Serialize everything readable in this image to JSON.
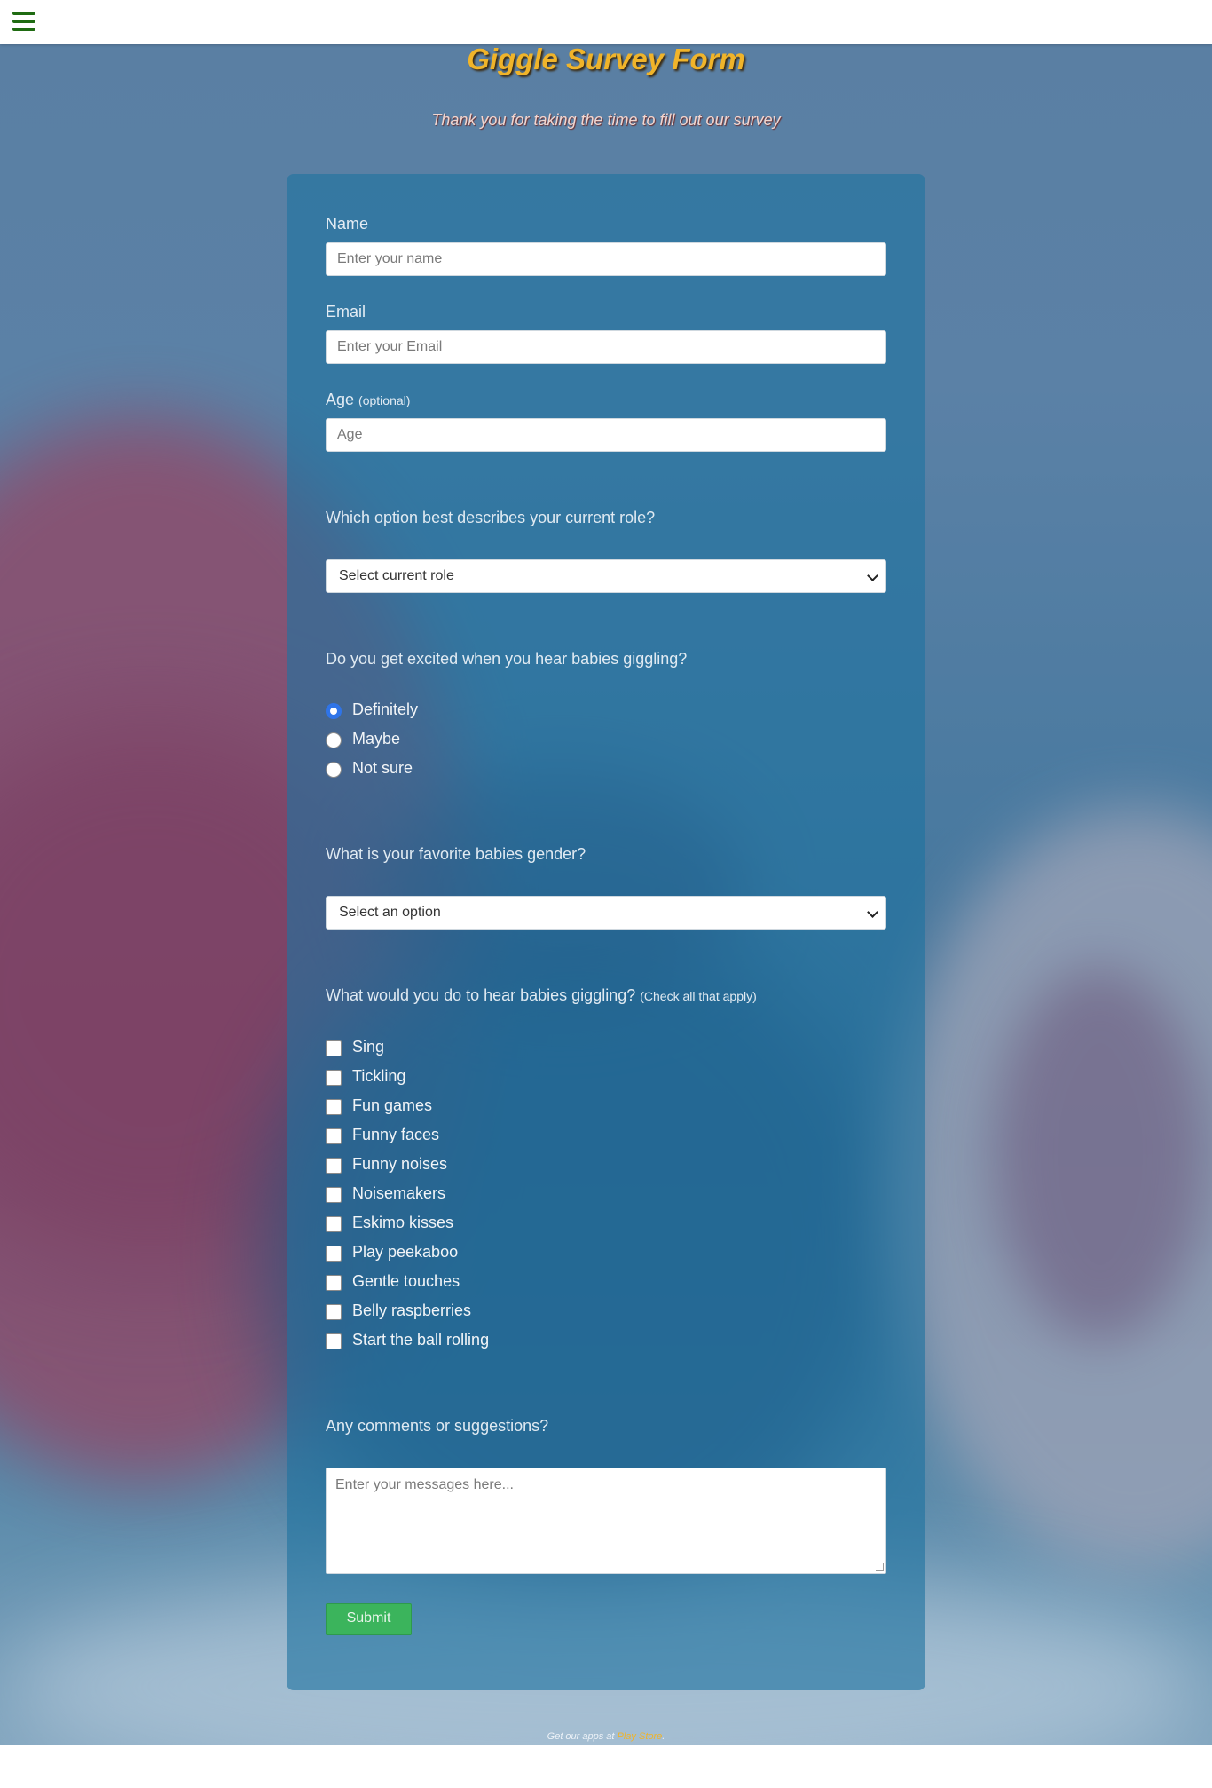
{
  "header": {
    "menu_icon": "hamburger-menu-icon"
  },
  "page": {
    "title": "Giggle Survey Form",
    "subtitle": "Thank you for taking the time to fill out our survey"
  },
  "form": {
    "name": {
      "label": "Name",
      "placeholder": "Enter your name"
    },
    "email": {
      "label": "Email",
      "placeholder": "Enter your Email"
    },
    "age": {
      "label": "Age",
      "hint": "(optional)",
      "placeholder": "Age"
    },
    "role": {
      "question": "Which option best describes your current role?",
      "selected": "Select current role"
    },
    "excited": {
      "question": "Do you get excited when you hear babies giggling?",
      "options": [
        "Definitely",
        "Maybe",
        "Not sure"
      ],
      "selected_index": 0
    },
    "gender": {
      "question": "What is your favorite babies gender?",
      "selected": "Select an option"
    },
    "activities": {
      "question": "What would you do to hear babies giggling?",
      "hint": "(Check all that apply)",
      "options": [
        "Sing",
        "Tickling",
        "Fun games",
        "Funny faces",
        "Funny noises",
        "Noisemakers",
        "Eskimo kisses",
        "Play peekaboo",
        "Gentle touches",
        "Belly raspberries",
        "Start the ball rolling"
      ]
    },
    "comments": {
      "question": "Any comments or suggestions?",
      "placeholder": "Enter your messages here..."
    },
    "submit_label": "Submit"
  },
  "footer": {
    "text": "Get our apps at",
    "link_text": "Play Store",
    "suffix": "."
  },
  "colors": {
    "title": "#f0b42a",
    "header_icon": "#1f6b12",
    "submit": "#3bb45c",
    "radio_selected": "#2f74e8"
  }
}
